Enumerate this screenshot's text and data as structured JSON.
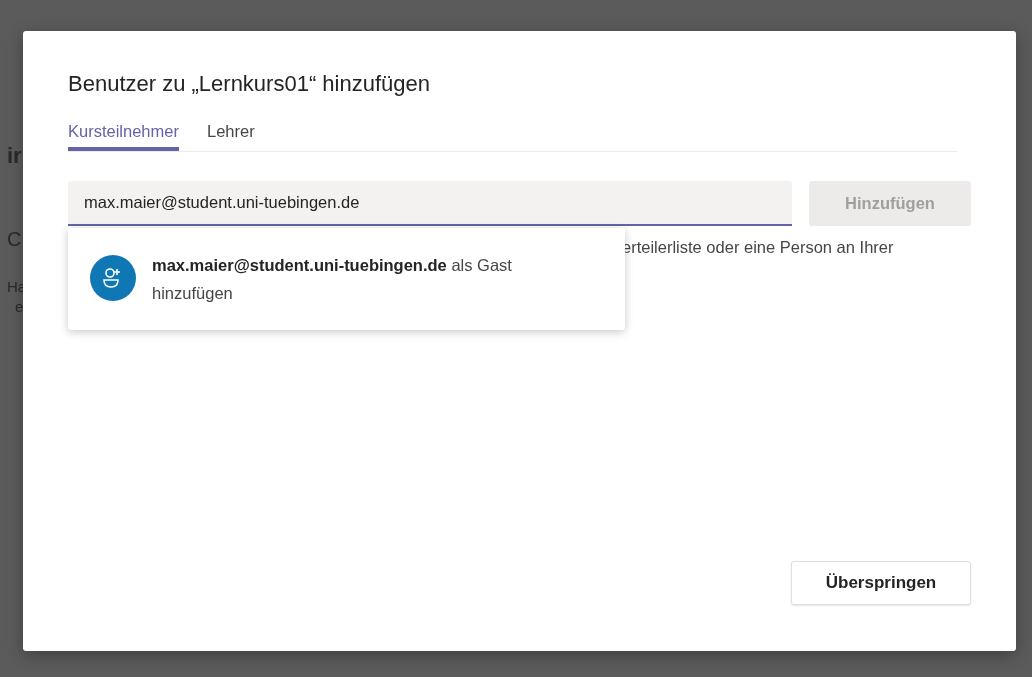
{
  "background_fragments": [
    "ir",
    "C",
    "Ha",
    "e"
  ],
  "dialog": {
    "title": "Benutzer zu „Lernkurs01“ hinzufügen",
    "tabs": [
      {
        "label": "Kursteilnehmer",
        "selected": true
      },
      {
        "label": "Lehrer",
        "selected": false
      }
    ],
    "input": {
      "value": "max.maier@student.uni-tuebingen.de"
    },
    "add_button": {
      "label": "Hinzufügen",
      "disabled": true
    },
    "hint": "erteilerliste oder eine Person an Ihrer",
    "suggestion": {
      "text": "**max.maier@student.uni-tuebingen.de** als Gast hinzufügen"
    },
    "skip_button": {
      "label": "Überspringen"
    }
  }
}
